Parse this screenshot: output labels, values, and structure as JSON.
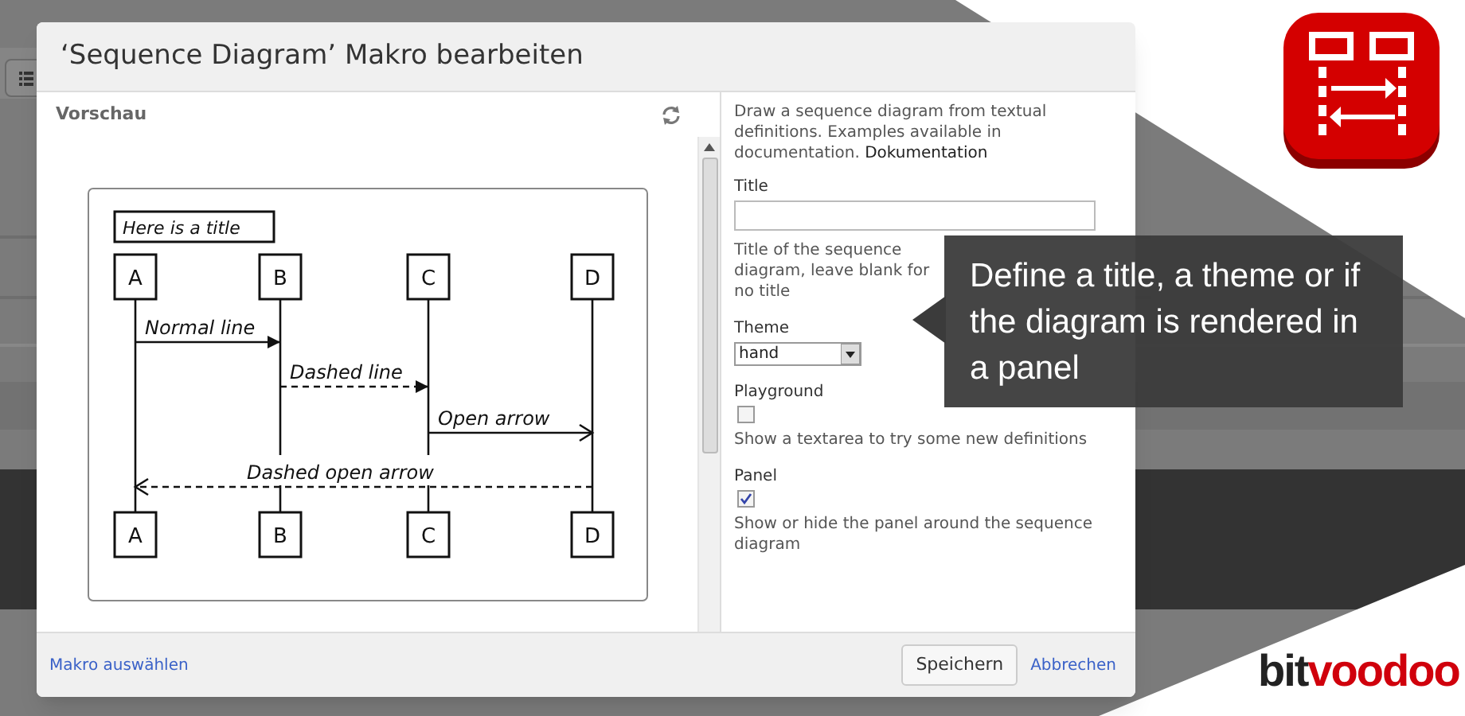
{
  "dialog": {
    "title": "‘Sequence Diagram’ Makro bearbeiten",
    "preview": {
      "heading": "Vorschau",
      "diagram": {
        "title": "Here is a title",
        "participants": [
          {
            "top": "A",
            "bottom": "A"
          },
          {
            "top": "B",
            "bottom": "B"
          },
          {
            "top": "C",
            "bottom": "C"
          },
          {
            "top": "D",
            "bottom": "D"
          }
        ],
        "messages": [
          {
            "label": "Normal line",
            "dashed": false,
            "open_head": false
          },
          {
            "label": "Dashed line",
            "dashed": true,
            "open_head": false
          },
          {
            "label": "Open arrow",
            "dashed": false,
            "open_head": true
          },
          {
            "label": "Dashed open arrow",
            "dashed": true,
            "open_head": true
          }
        ]
      }
    },
    "description": {
      "text": "Draw a sequence diagram from textual definitions. Examples available in documentation.",
      "link": "Dokumentation"
    },
    "fields": [
      {
        "kind": "text",
        "label": "Title",
        "hint": "Title of the sequence diagram, leave blank for no title"
      },
      {
        "kind": "select",
        "label": "Theme",
        "value": "hand"
      },
      {
        "kind": "checkbox",
        "label": "Playground",
        "checked": false,
        "hint": "Show a textarea to try some new definitions"
      },
      {
        "kind": "checkbox",
        "label": "Panel",
        "checked": true,
        "hint": "Show or hide the panel around the sequence diagram"
      }
    ],
    "footer": {
      "link": "Makro auswählen",
      "save": "Speichern",
      "cancel": "Abbrechen"
    }
  },
  "tooltip": "Define a title, a theme or if the diagram is rendered in a panel",
  "brand_logo": [
    {
      "text": "bit"
    },
    {
      "text": "voodoo"
    }
  ]
}
